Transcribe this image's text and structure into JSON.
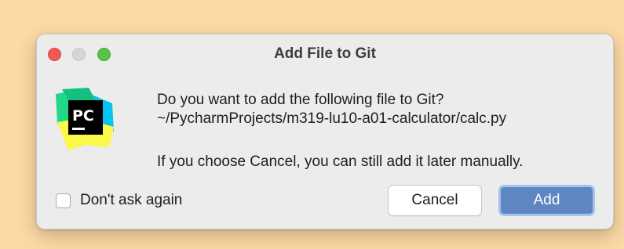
{
  "dialog": {
    "title": "Add File to Git",
    "message_line1": "Do you want to add the following file to Git?",
    "message_line2": "~/PycharmProjects/m319-lu10-a01-calculator/calc.py",
    "message_line3": "If you choose Cancel, you can still add it later manually.",
    "checkbox_label": "Don't ask again",
    "checkbox_checked": false,
    "cancel_label": "Cancel",
    "add_label": "Add",
    "app_icon": "pycharm-icon",
    "app_icon_text": "PC"
  },
  "colors": {
    "backdrop": "#fdd9a5",
    "dialog_bg": "#ececec",
    "close": "#ee5a52",
    "minimize": "#d6d6d6",
    "zoom": "#5ac24a",
    "primary_button": "#5d86c2",
    "primary_focus_ring": "#a7c3ea"
  }
}
